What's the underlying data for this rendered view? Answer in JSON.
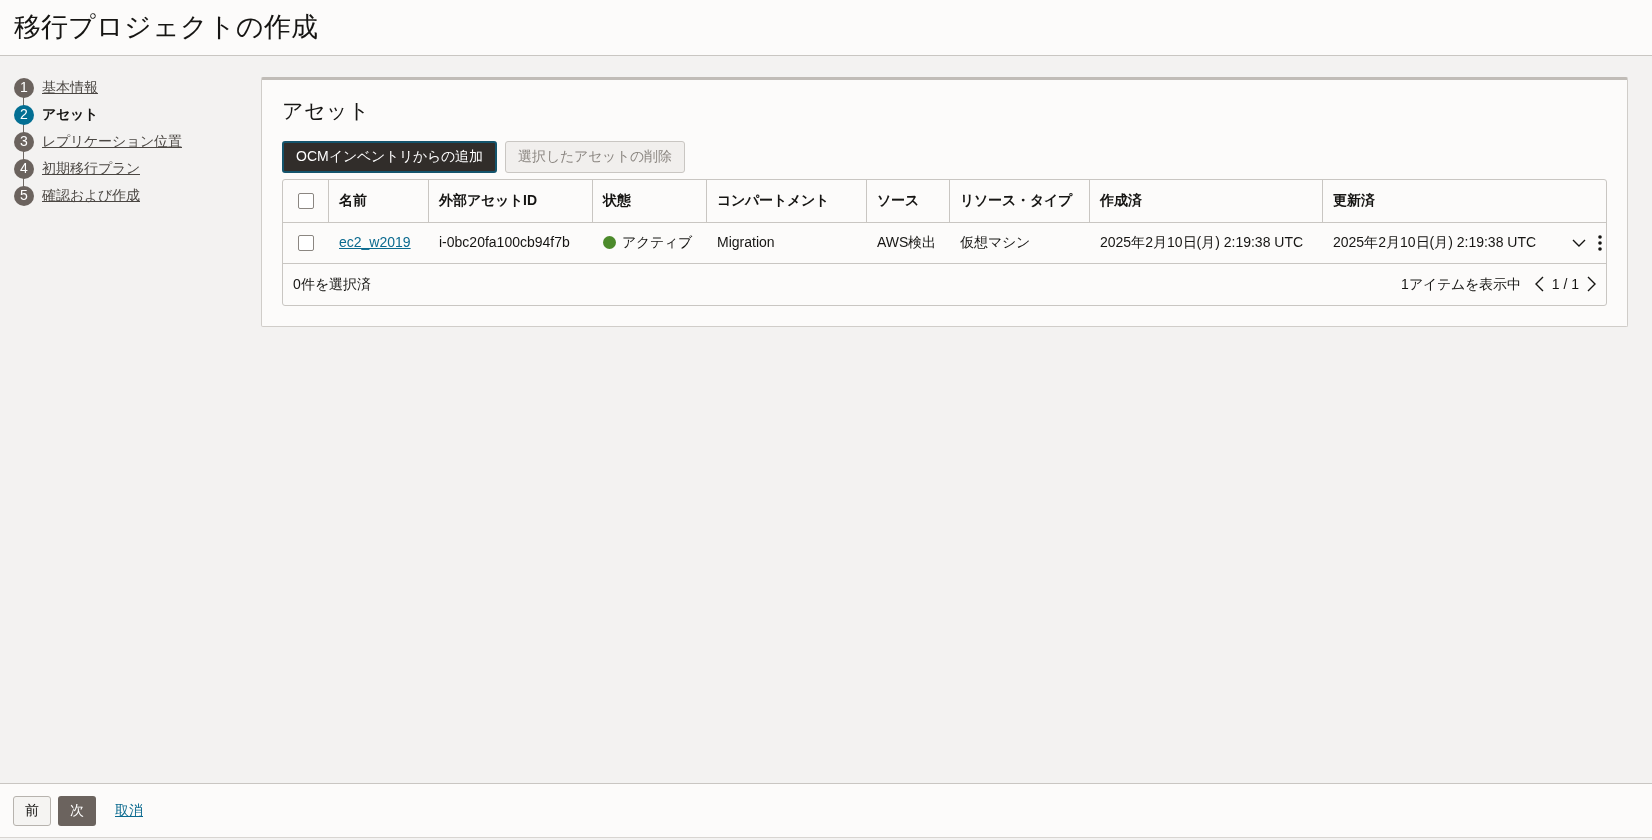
{
  "page": {
    "title": "移行プロジェクトの作成"
  },
  "steps": [
    {
      "number": "1",
      "label": "基本情報",
      "selected": false
    },
    {
      "number": "2",
      "label": "アセット",
      "selected": true
    },
    {
      "number": "3",
      "label": "レプリケーション位置",
      "selected": false
    },
    {
      "number": "4",
      "label": "初期移行プラン",
      "selected": false
    },
    {
      "number": "5",
      "label": "確認および作成",
      "selected": false
    }
  ],
  "panel": {
    "title": "アセット",
    "toolbar": [
      {
        "label": "OCMインベントリからの追加",
        "kind": "primary",
        "disabled": false
      },
      {
        "label": "選択したアセットの削除",
        "kind": "secondary",
        "disabled": true
      }
    ],
    "table": {
      "select_all_checked": false,
      "columns": [
        "名前",
        "外部アセットID",
        "状態",
        "コンパートメント",
        "ソース",
        "リソース・タイプ",
        "作成済",
        "更新済"
      ],
      "rows": [
        {
          "checked": false,
          "name": "ec2_w2019",
          "external_id": "i-0bc20fa100cb94f7b",
          "status": {
            "text": "アクティブ",
            "color": "#4c8a2b"
          },
          "compartment": "Migration",
          "source": "AWS検出",
          "resource_type": "仮想マシン",
          "created": "2025年2月10日(月) 2:19:38 UTC",
          "updated": "2025年2月10日(月) 2:19:38 UTC"
        }
      ],
      "footer": {
        "selected_count": "0件を選択済",
        "showing": "1アイテムを表示中",
        "page": "1 / 1"
      }
    }
  },
  "footer": {
    "buttons": [
      {
        "label": "前",
        "kind": "secondary"
      },
      {
        "label": "次",
        "kind": "primary"
      },
      {
        "label": "取消",
        "kind": "link"
      }
    ]
  }
}
